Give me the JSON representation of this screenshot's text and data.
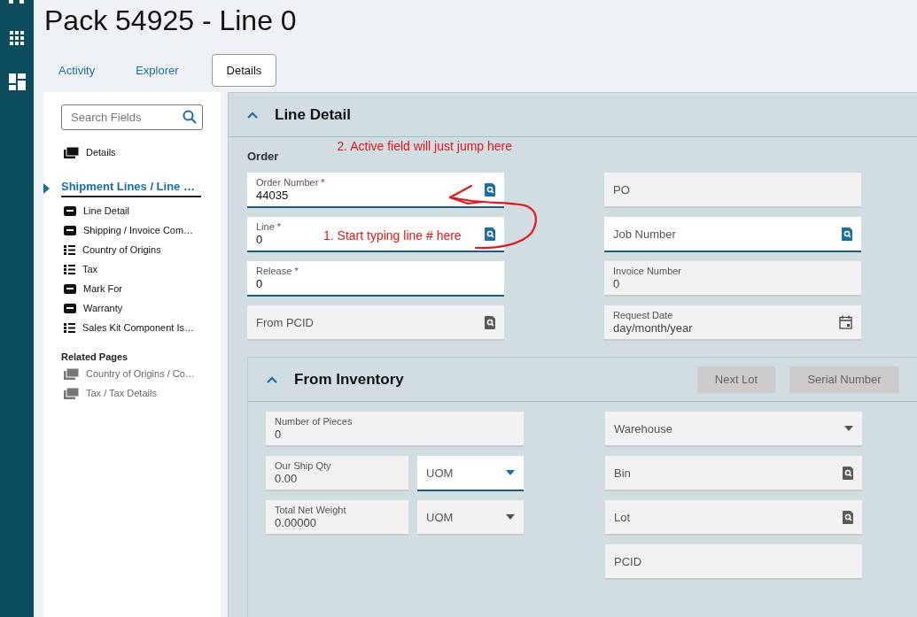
{
  "title": "Pack 54925 - Line 0",
  "tabs": [
    {
      "label": "Activity",
      "selected": false
    },
    {
      "label": "Explorer",
      "selected": false
    },
    {
      "label": "Details",
      "selected": true
    }
  ],
  "sidebar": {
    "search": {
      "placeholder": "Search Fields"
    },
    "items": [
      {
        "label": "Details",
        "kind": "pages",
        "selected": false
      },
      {
        "label": "Shipment Lines / Line …",
        "kind": "group",
        "selected": true,
        "children": [
          {
            "label": "Line Detail",
            "kind": "form",
            "selected": false
          },
          {
            "label": "Shipping / Invoice Com…",
            "kind": "form",
            "selected": false
          },
          {
            "label": "Country of Origins",
            "kind": "list",
            "selected": false
          },
          {
            "label": "Tax",
            "kind": "list",
            "selected": false
          },
          {
            "label": "Mark For",
            "kind": "form",
            "selected": false
          },
          {
            "label": "Warranty",
            "kind": "form",
            "selected": false
          },
          {
            "label": "Sales Kit Component Is…",
            "kind": "list",
            "selected": false
          }
        ]
      }
    ],
    "related_title": "Related Pages",
    "related": [
      {
        "label": "Country of Origins / Co…"
      },
      {
        "label": "Tax / Tax Details"
      }
    ]
  },
  "section": {
    "title": "Line Detail",
    "expanded": true,
    "group_label": "Order",
    "group_note": "2. Active field will just jump here",
    "left": [
      {
        "label": "Order Number *",
        "value": "44035",
        "editable": true,
        "kind": "lookup"
      },
      {
        "label": "Line *",
        "value": "0",
        "editable": true,
        "kind": "lookup",
        "note": "1. Start typing line # here"
      },
      {
        "label": "Release *",
        "value": "0",
        "editable": true,
        "kind": "text"
      },
      {
        "label": "From PCID",
        "editable": false,
        "kind": "lookup"
      }
    ],
    "right": [
      {
        "label": "PO",
        "editable": false,
        "kind": "text"
      },
      {
        "label": "Job Number",
        "editable": true,
        "kind": "lookup"
      },
      {
        "label": "Invoice Number",
        "value": "0",
        "editable": false,
        "kind": "text"
      },
      {
        "label": "Request Date",
        "placeholder": "day/month/year",
        "editable": false,
        "kind": "date"
      }
    ]
  },
  "inventory": {
    "title": "From Inventory",
    "expanded": true,
    "buttons": [
      {
        "label": "Next Lot",
        "disabled": true
      },
      {
        "label": "Serial Number",
        "disabled": true
      }
    ],
    "left": [
      {
        "label": "Number of Pieces",
        "value": "0",
        "editable": false
      },
      {
        "label": "Our Ship Qty",
        "value": "0.00",
        "editable": false,
        "unit": {
          "label": "UOM",
          "editable": true
        }
      },
      {
        "label": "Total Net Weight",
        "value": "0.00000",
        "editable": false,
        "unit": {
          "label": "UOM",
          "editable": false
        }
      }
    ],
    "right": [
      {
        "label": "Warehouse",
        "editable": false,
        "kind": "select"
      },
      {
        "label": "Bin",
        "editable": false,
        "kind": "lookup"
      },
      {
        "label": "Lot",
        "editable": false,
        "kind": "lookup"
      },
      {
        "label": "PCID",
        "editable": false,
        "kind": "text"
      }
    ]
  }
}
